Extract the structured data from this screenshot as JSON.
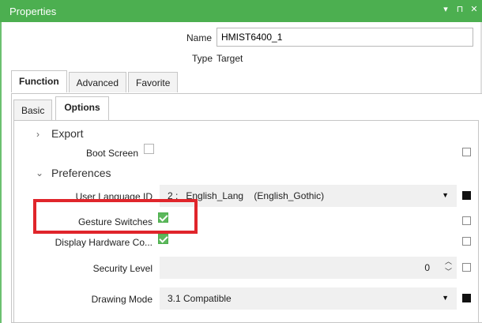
{
  "window": {
    "title": "Properties",
    "controls": [
      "▾",
      "⊓",
      "✕"
    ]
  },
  "header": {
    "name_label": "Name",
    "name_value": "HMIST6400_1",
    "type_label": "Type",
    "type_value": "Target"
  },
  "tabs": [
    "Function",
    "Advanced",
    "Favorite"
  ],
  "subtabs": [
    "Basic",
    "Options"
  ],
  "sections": {
    "export": {
      "label": "Export",
      "boot_screen_label": "Boot Screen",
      "boot_screen_checked": false
    },
    "preferences": {
      "label": "Preferences",
      "user_language_label": "User Language ID",
      "user_language_value": "2 :   English_Lang    (English_Gothic)",
      "gesture_label": "Gesture Switches",
      "gesture_checked": true,
      "display_hw_label": "Display Hardware Co...",
      "display_hw_checked": true,
      "security_label": "Security Level",
      "security_value": "0",
      "drawing_mode_label": "Drawing Mode",
      "drawing_mode_value": "3.1 Compatible"
    }
  },
  "colors": {
    "accent": "#4caf50",
    "highlight": "#e0252b",
    "check": "#5cb85c"
  }
}
